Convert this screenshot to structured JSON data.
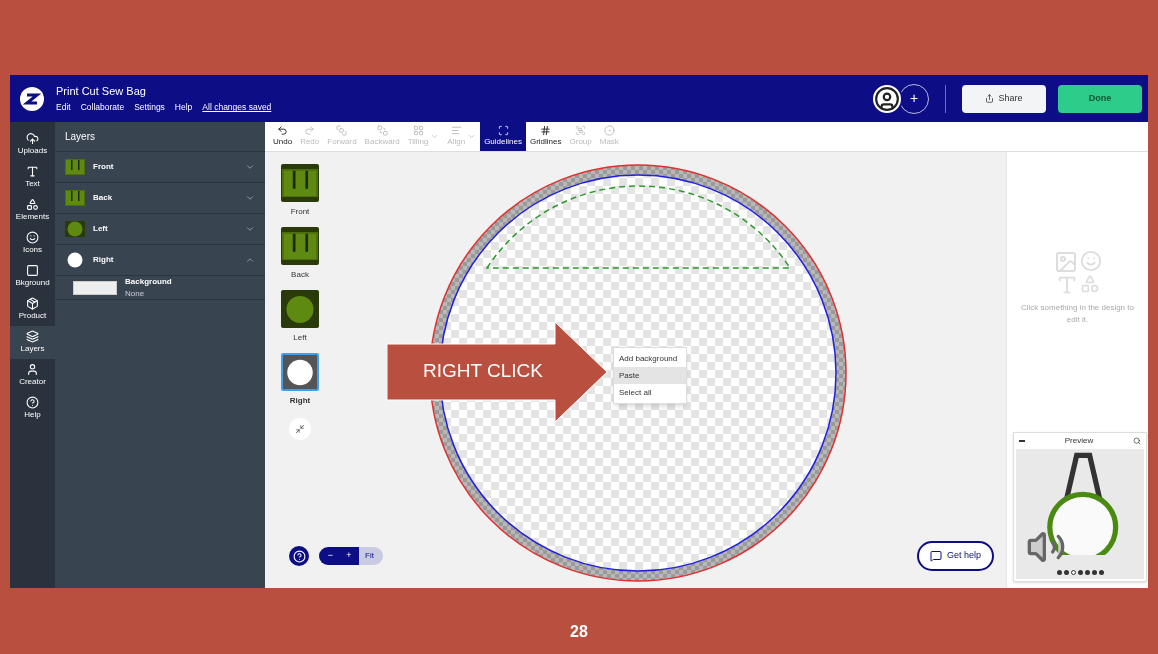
{
  "slide": {
    "page_number": "28",
    "callout": "RIGHT CLICK"
  },
  "header": {
    "title": "Print Cut Sew Bag",
    "menu": [
      "Edit",
      "Collaborate",
      "Settings",
      "Help"
    ],
    "save_status": "All changes saved",
    "share": "Share",
    "done": "Done",
    "add": "+"
  },
  "rail": [
    {
      "label": "Uploads",
      "selected": false
    },
    {
      "label": "Text",
      "selected": false
    },
    {
      "label": "Elements",
      "selected": false
    },
    {
      "label": "Icons",
      "selected": false
    },
    {
      "label": "Bkground",
      "selected": false
    },
    {
      "label": "Product",
      "selected": false
    },
    {
      "label": "Layers",
      "selected": true
    },
    {
      "label": "Creator",
      "selected": false
    },
    {
      "label": "Help",
      "selected": false
    }
  ],
  "layers_panel": {
    "title": "Layers",
    "layers": [
      {
        "name": "Front",
        "kind": "rect",
        "expanded": false
      },
      {
        "name": "Back",
        "kind": "rect",
        "expanded": false
      },
      {
        "name": "Left",
        "kind": "circle",
        "expanded": false
      },
      {
        "name": "Right",
        "kind": "blank",
        "expanded": true,
        "children": [
          {
            "name": "Background",
            "detail": "None"
          }
        ]
      }
    ]
  },
  "toolbar": [
    {
      "label": "Undo",
      "disabled": false,
      "active": false,
      "dropdown": false
    },
    {
      "label": "Redo",
      "disabled": true,
      "active": false,
      "dropdown": false
    },
    {
      "label": "Forward",
      "disabled": true,
      "active": false,
      "dropdown": false
    },
    {
      "label": "Backward",
      "disabled": true,
      "active": false,
      "dropdown": false
    },
    {
      "label": "Tilling",
      "disabled": true,
      "active": false,
      "dropdown": true
    },
    {
      "label": "Align",
      "disabled": true,
      "active": false,
      "dropdown": true
    },
    {
      "label": "Guidelines",
      "disabled": false,
      "active": true,
      "dropdown": false
    },
    {
      "label": "Gridlines",
      "disabled": false,
      "active": false,
      "dropdown": false
    },
    {
      "label": "Group",
      "disabled": true,
      "active": false,
      "dropdown": false
    },
    {
      "label": "Mask",
      "disabled": true,
      "active": false,
      "dropdown": false
    }
  ],
  "sides": [
    {
      "label": "Front",
      "kind": "rect",
      "selected": false
    },
    {
      "label": "Back",
      "kind": "rect",
      "selected": false
    },
    {
      "label": "Left",
      "kind": "circle",
      "selected": false
    },
    {
      "label": "Right",
      "kind": "blank",
      "selected": true
    }
  ],
  "context_menu": [
    {
      "label": "Add background",
      "selected": false
    },
    {
      "label": "Paste",
      "selected": true
    },
    {
      "label": "Select all",
      "selected": false
    }
  ],
  "zoom": {
    "minus": "−",
    "plus": "+",
    "fit": "Fit"
  },
  "properties": {
    "hint": "Click something in the design to edit it."
  },
  "preview": {
    "title": "Preview",
    "dots": [
      {
        "selected": false
      },
      {
        "selected": false
      },
      {
        "selected": true
      },
      {
        "selected": false
      },
      {
        "selected": false
      },
      {
        "selected": false
      },
      {
        "selected": false
      }
    ]
  },
  "get_help": "Get help"
}
